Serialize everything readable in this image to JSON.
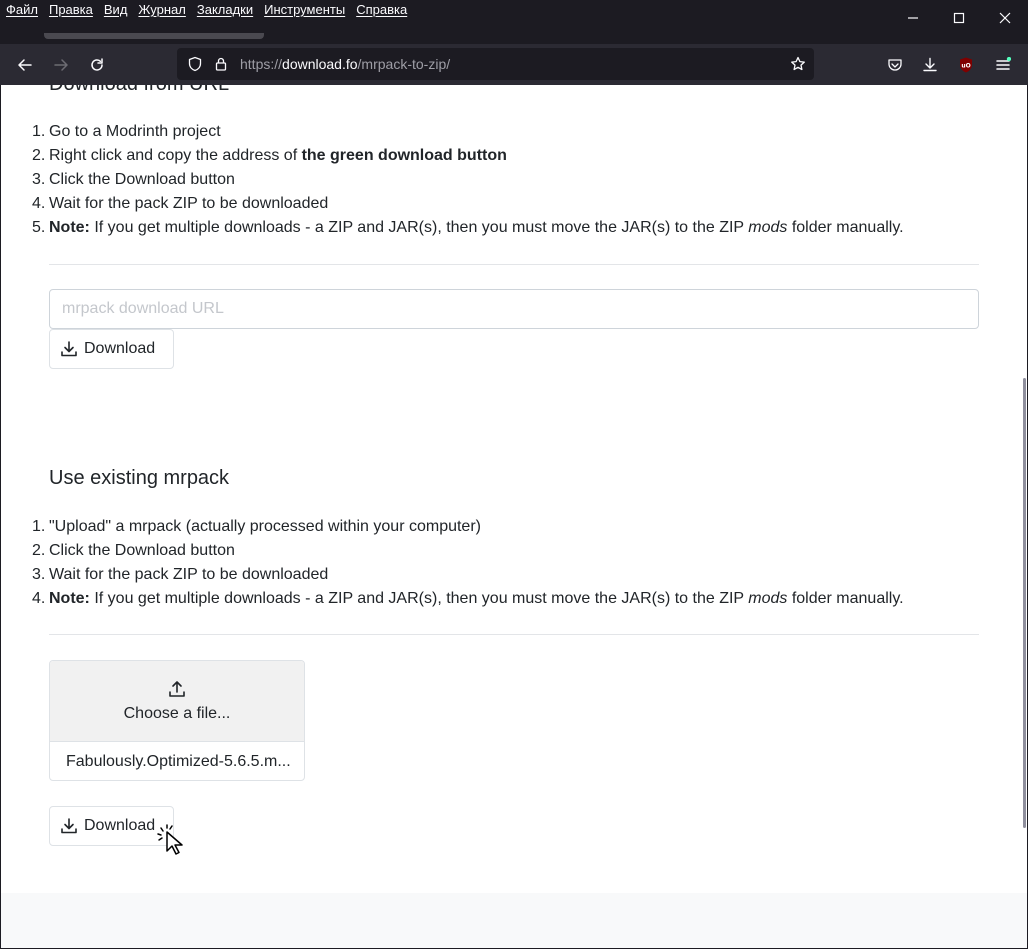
{
  "menu": {
    "items": [
      "Файл",
      "Правка",
      "Вид",
      "Журнал",
      "Закладки",
      "Инструменты",
      "Справка"
    ]
  },
  "window_controls": {
    "minimize_icon": "minimize-icon",
    "maximize_icon": "maximize-icon",
    "close_icon": "close-icon"
  },
  "toolbar": {
    "url_prefix": "https://",
    "url_host": "download.fo",
    "url_path": "/mrpack-to-zip/"
  },
  "section1": {
    "title_partial": "Download from URL",
    "steps": [
      {
        "num": "1.",
        "text": "Go to a Modrinth project"
      },
      {
        "num": "2.",
        "text_before": "Right click and copy the address of ",
        "bold": "the green download button"
      },
      {
        "num": "3.",
        "text": "Click the Download button"
      },
      {
        "num": "4.",
        "text": "Wait for the pack ZIP to be downloaded"
      },
      {
        "num": "5.",
        "note": "Note:",
        "text_before": " If you get multiple downloads - a ZIP and JAR(s), then you must move the JAR(s) to the ZIP ",
        "italic": "mods",
        "text_after": " folder manually."
      }
    ],
    "input_placeholder": "mrpack download URL",
    "download_label": "Download"
  },
  "section2": {
    "title": "Use existing mrpack",
    "steps": [
      {
        "num": "1.",
        "text": "\"Upload\" a mrpack (actually processed within your computer)"
      },
      {
        "num": "2.",
        "text": "Click the Download button"
      },
      {
        "num": "3.",
        "text": "Wait for the pack ZIP to be downloaded"
      },
      {
        "num": "4.",
        "note": "Note:",
        "text_before": " If you get multiple downloads - a ZIP and JAR(s), then you must move the JAR(s) to the ZIP ",
        "italic": "mods",
        "text_after": " folder manually."
      }
    ],
    "choose_label": "Choose a file...",
    "file_name": "Fabulously.Optimized-5.6.5.m...",
    "download_label": "Download"
  },
  "colors": {
    "chrome_dark": "#1c1b22",
    "toolbar": "#2b2a33",
    "ublock_red": "#800000",
    "text": "#212529"
  }
}
